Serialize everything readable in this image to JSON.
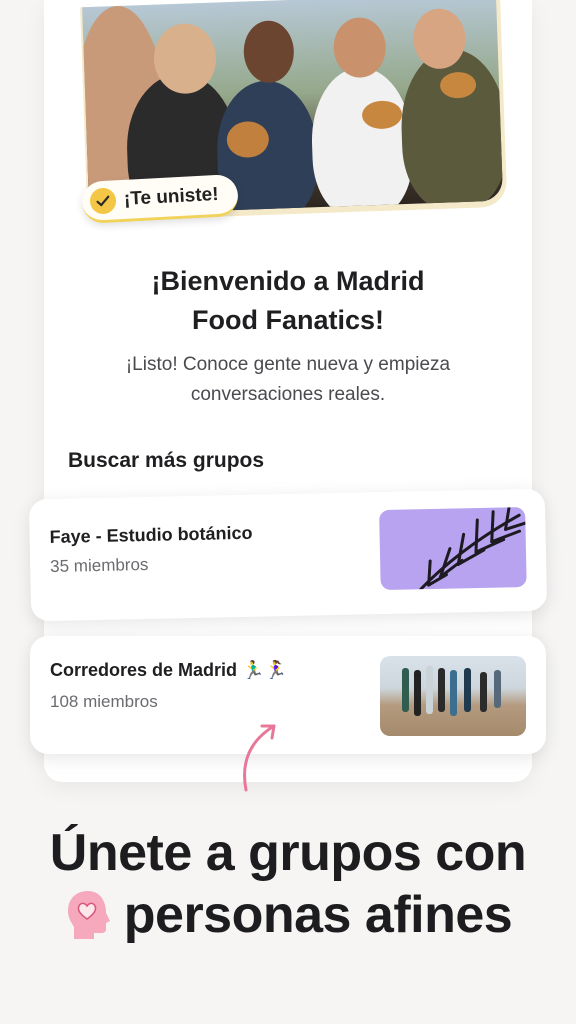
{
  "hero": {
    "badge_label": "¡Te uniste!",
    "badge_icon": "check-icon"
  },
  "welcome": {
    "title_line1": "¡Bienvenido a Madrid",
    "title_line2": "Food Fanatics!",
    "subtitle_line1": "¡Listo! Conoce gente nueva y empieza",
    "subtitle_line2": "conversaciones reales."
  },
  "groups": {
    "section_title": "Buscar más grupos",
    "items": [
      {
        "name": "Faye - Estudio botánico",
        "members": "35 miembros",
        "thumb_icon": "palm-leaf-image"
      },
      {
        "name": "Corredores de Madrid 🏃‍♂️🏃‍♀️",
        "members": "108 miembros",
        "thumb_icon": "runners-photo"
      }
    ]
  },
  "headline": {
    "line1": "Únete a grupos con",
    "line2": "personas afines",
    "icon": "head-heart-icon"
  },
  "colors": {
    "badge_check": "#f3c745",
    "badge_underline": "#f1d35a",
    "thumb_purple": "#b8a3f0",
    "arrow_pink": "#e8789a",
    "icon_pink": "#f08aa8"
  }
}
